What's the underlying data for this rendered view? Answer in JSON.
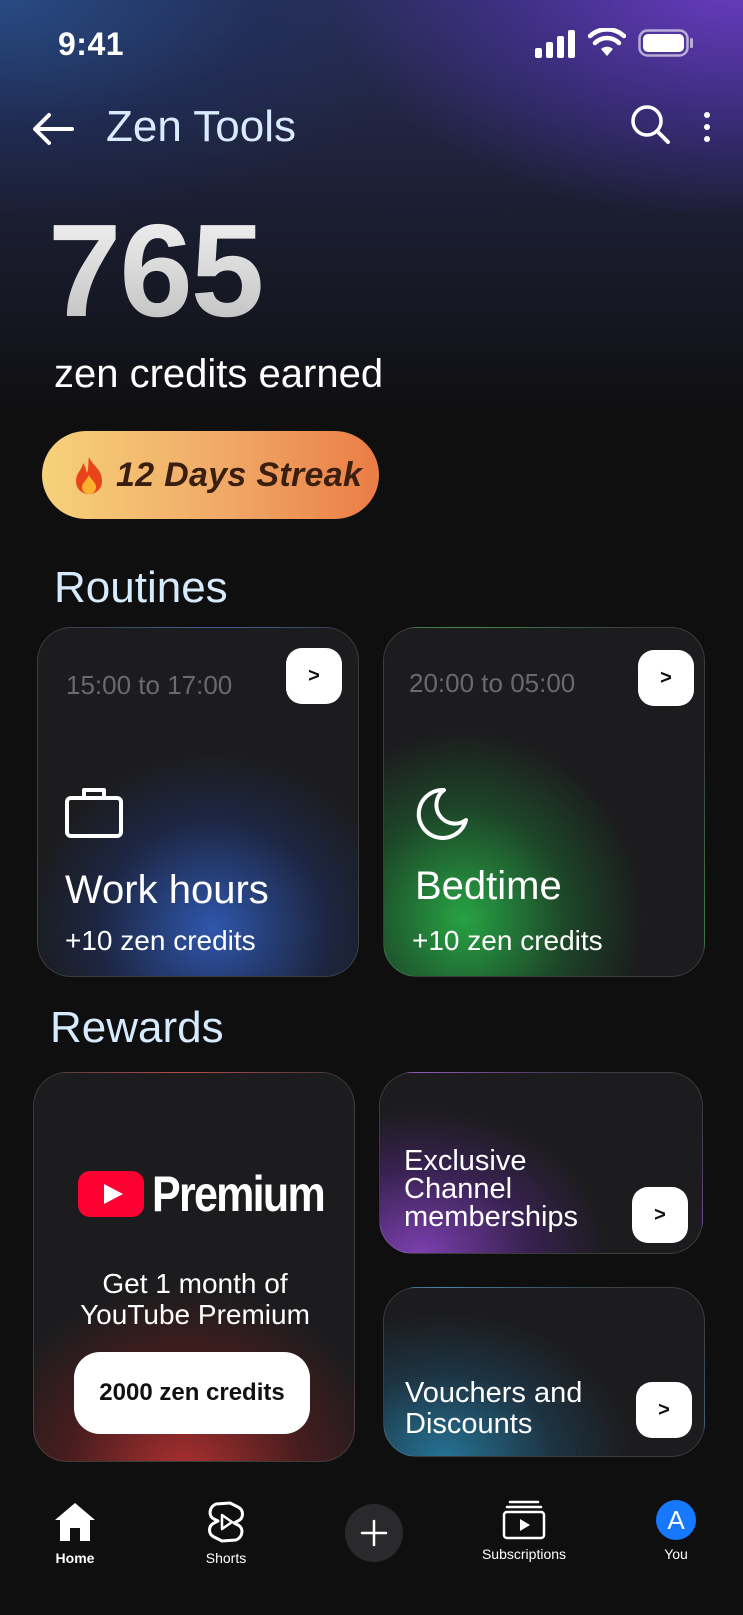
{
  "status_bar": {
    "time": "9:41"
  },
  "app_bar": {
    "title": "Zen Tools"
  },
  "summary": {
    "credits": "765",
    "credits_label": "zen credits earned",
    "streak": "12 Days Streak"
  },
  "routines": {
    "title": "Routines",
    "items": [
      {
        "time": "15:00 to 17:00",
        "name": "Work hours",
        "reward": "+10 zen credits",
        "icon": "briefcase-icon",
        "accent": "#305ab4"
      },
      {
        "time": "20:00 to 05:00",
        "name": "Bedtime",
        "reward": "+10 zen credits",
        "icon": "moon-icon",
        "accent": "#28aa46"
      }
    ],
    "arrow_label": ">"
  },
  "rewards": {
    "title": "Rewards",
    "premium": {
      "logo_text": "Premium",
      "description_line1": "Get 1 month of",
      "description_line2": "YouTube Premium",
      "cta": "2000 zen credits",
      "accent": "#be3232"
    },
    "channel": {
      "line1": "Exclusive",
      "line2": "Channel",
      "line3": "memberships",
      "accent": "#8c46c8"
    },
    "vouchers": {
      "line1": "Vouchers and",
      "line2": "Discounts",
      "accent": "#2882aa"
    },
    "arrow_label": ">"
  },
  "bottom_nav": {
    "items": [
      {
        "label": "Home",
        "icon": "home-icon"
      },
      {
        "label": "Shorts",
        "icon": "shorts-icon"
      },
      {
        "label": "Create",
        "icon": "plus-icon"
      },
      {
        "label": "Subscriptions",
        "icon": "subscriptions-icon"
      },
      {
        "label": "You",
        "icon": "avatar",
        "avatar_letter": "A"
      }
    ]
  },
  "colors": {
    "background": "#0f0f10",
    "title_blue": "#d7ebff",
    "youtube_red": "#ff0033",
    "avatar_blue": "#1677ff"
  }
}
